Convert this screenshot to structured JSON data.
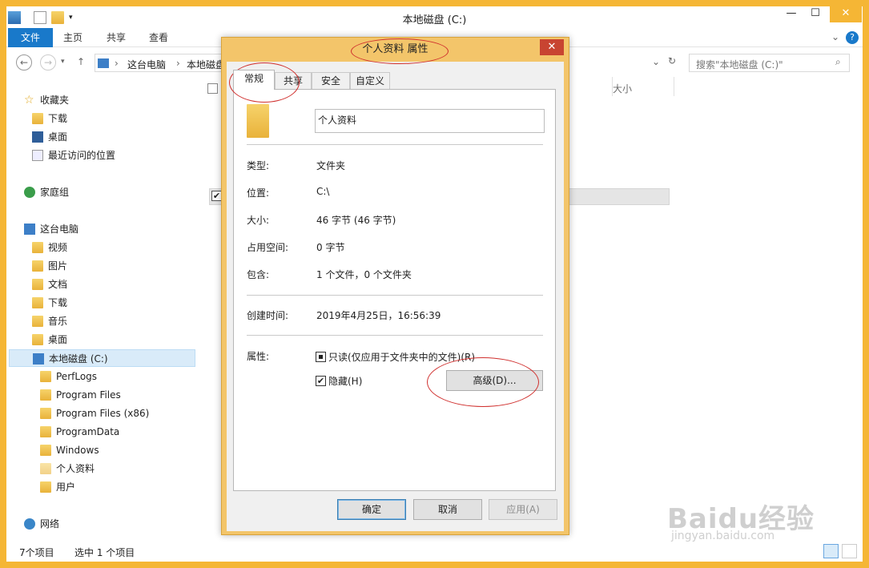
{
  "window": {
    "title": "本地磁盘 (C:)",
    "minimize": "—",
    "maximize": "☐",
    "close": "✕"
  },
  "ribbon": {
    "tabs": [
      "文件",
      "主页",
      "共享",
      "查看"
    ]
  },
  "address": {
    "segments": [
      "这台电脑",
      "本地磁盘 (C:)"
    ],
    "search_placeholder": "搜索\"本地磁盘 (C:)\""
  },
  "nav": {
    "favorites": "收藏夹",
    "downloads": "下载",
    "desktop": "桌面",
    "recent": "最近访问的位置",
    "homegroup": "家庭组",
    "thispc": "这台电脑",
    "pc_items": [
      "视频",
      "图片",
      "文档",
      "下载",
      "音乐",
      "桌面"
    ],
    "drive": "本地磁盘 (C:)",
    "drive_items": [
      "PerfLogs",
      "Program Files",
      "Program Files (x86)",
      "ProgramData",
      "Windows",
      "个人资料",
      "用户"
    ],
    "network": "网络"
  },
  "list": {
    "col_size": "大小"
  },
  "status": {
    "count": "7个项目",
    "selected": "选中 1 个项目"
  },
  "dialog": {
    "title": "个人资料 属性",
    "tabs": [
      "常规",
      "共享",
      "安全",
      "自定义"
    ],
    "name": "个人资料",
    "type_label": "类型:",
    "type": "文件夹",
    "loc_label": "位置:",
    "loc": "C:\\",
    "size_label": "大小:",
    "size": "46 字节 (46 字节)",
    "disk_label": "占用空间:",
    "disk": "0 字节",
    "contains_label": "包含:",
    "contains": "1 个文件，0 个文件夹",
    "created_label": "创建时间:",
    "created": "2019年4月25日，16:56:39",
    "attr_label": "属性:",
    "readonly": "只读(仅应用于文件夹中的文件)(R)",
    "hidden": "隐藏(H)",
    "advanced": "高级(D)...",
    "ok": "确定",
    "cancel": "取消",
    "apply": "应用(A)"
  },
  "watermark": {
    "brand": "Baidu经验",
    "url": "jingyan.baidu.com"
  }
}
